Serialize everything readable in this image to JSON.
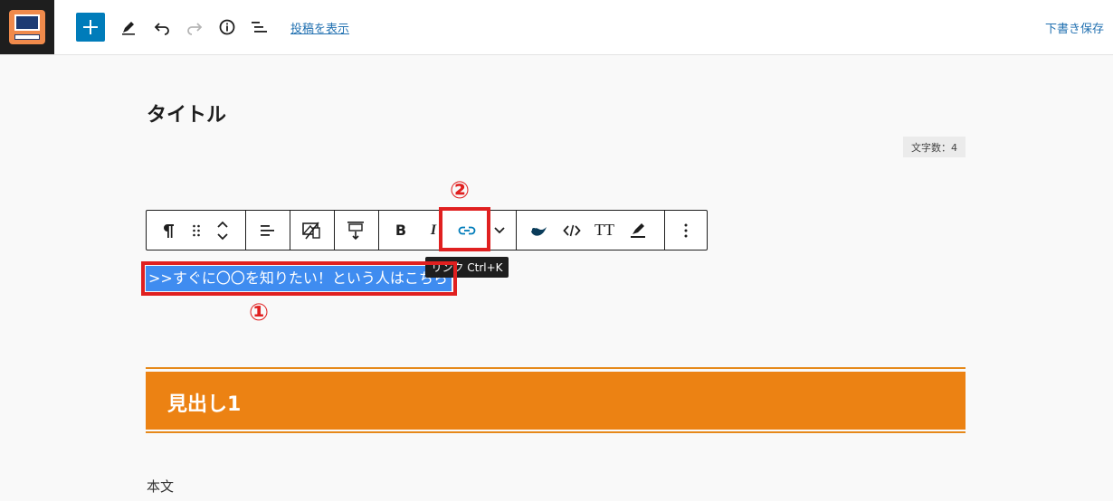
{
  "toolbar": {
    "view_post_label": "投稿を表示",
    "save_draft_label": "下書き保存",
    "icons": [
      "site-logo-icon",
      "plus-icon",
      "pen-icon",
      "undo-icon",
      "redo-icon",
      "info-icon",
      "list-view-icon"
    ]
  },
  "editor": {
    "title": "タイトル",
    "char_count": "文字数：4",
    "callouts": {
      "first": "①",
      "second": "②"
    },
    "block_toolbar": {
      "bold_label": "B",
      "italic_label": "I",
      "font_size_label": "TT",
      "tooltip": "リンク  Ctrl+K"
    },
    "selected_paragraph": ">>すぐに〇〇を知りたい！という人はこちら",
    "heading": "見出し1",
    "body_text": "本文"
  },
  "colors": {
    "accent": "#007cba",
    "link": "#2271b1",
    "heading_bg": "#ec8213",
    "selection": "#3f8cf0",
    "annotation": "#e02020"
  }
}
